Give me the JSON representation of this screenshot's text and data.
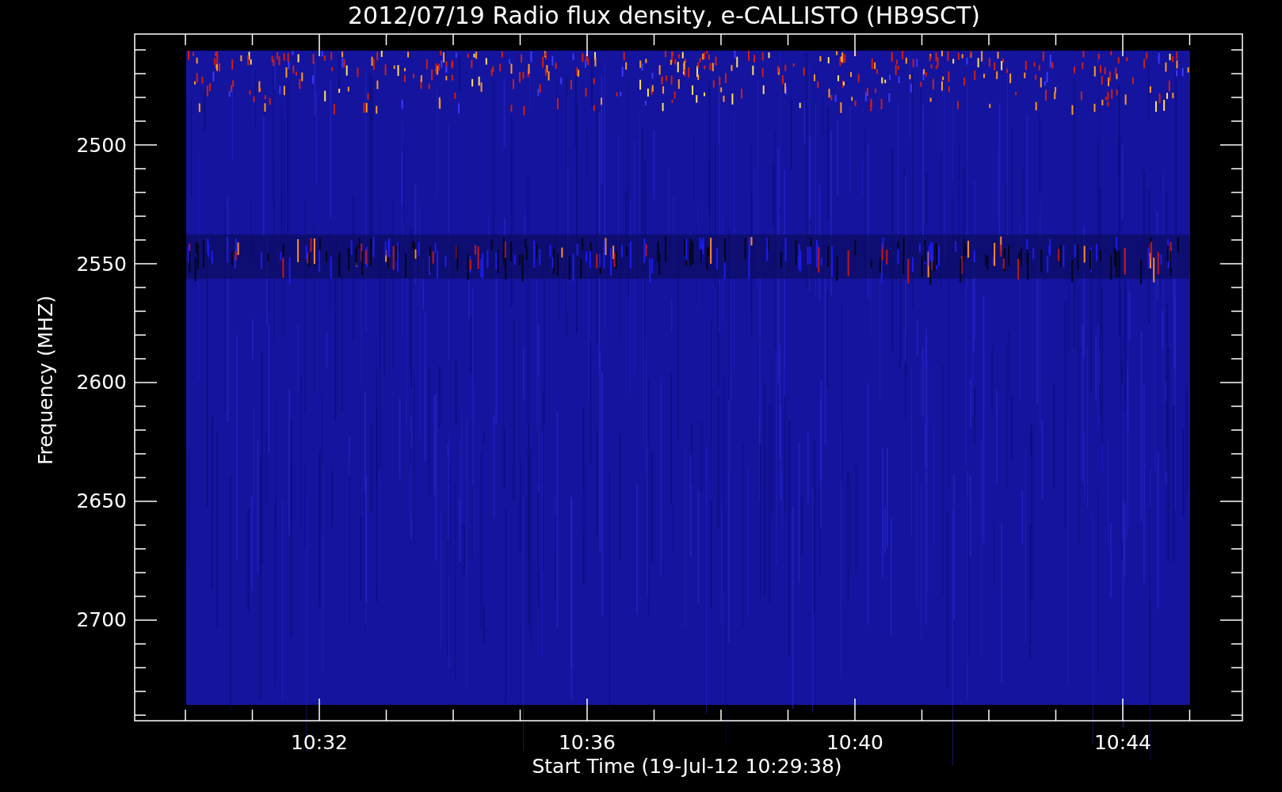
{
  "title": "2012/07/19  Radio flux density, e-CALLISTO (HB9SCT)",
  "ylabel": "Frequency (MHZ)",
  "xlabel": "Start Time (19-Jul-12 10:29:38)",
  "yticks": [
    "2500",
    "2550",
    "2600",
    "2650",
    "2700"
  ],
  "xticks": [
    "10:32",
    "10:36",
    "10:40",
    "10:44"
  ]
}
